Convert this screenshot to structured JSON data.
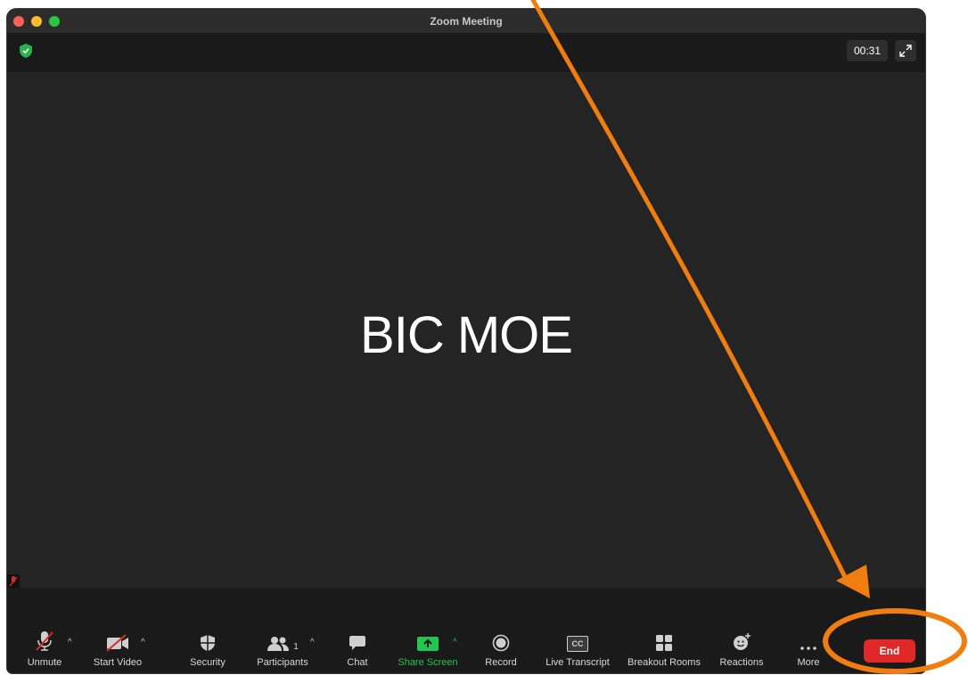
{
  "window": {
    "title": "Zoom Meeting"
  },
  "top_bar": {
    "timer": "00:31"
  },
  "main": {
    "participant_name": "BIC MOE"
  },
  "toolbar": {
    "unmute": "Unmute",
    "start_video": "Start Video",
    "security": "Security",
    "participants": "Participants",
    "participants_count": "1",
    "chat": "Chat",
    "share_screen": "Share Screen",
    "record": "Record",
    "live_transcript": "Live Transcript",
    "breakout_rooms": "Breakout Rooms",
    "reactions": "Reactions",
    "more": "More",
    "end": "End",
    "cc_label": "CC"
  },
  "colors": {
    "end": "#e02828",
    "share_screen": "#23c552",
    "annotation": "#f07d10"
  },
  "icons": [
    "shield-icon",
    "fullscreen-icon",
    "mic-muted-icon",
    "video-off-icon",
    "security-icon",
    "participants-icon",
    "chat-icon",
    "share-screen-icon",
    "record-icon",
    "cc-icon",
    "breakout-rooms-icon",
    "reactions-icon",
    "more-icon"
  ]
}
